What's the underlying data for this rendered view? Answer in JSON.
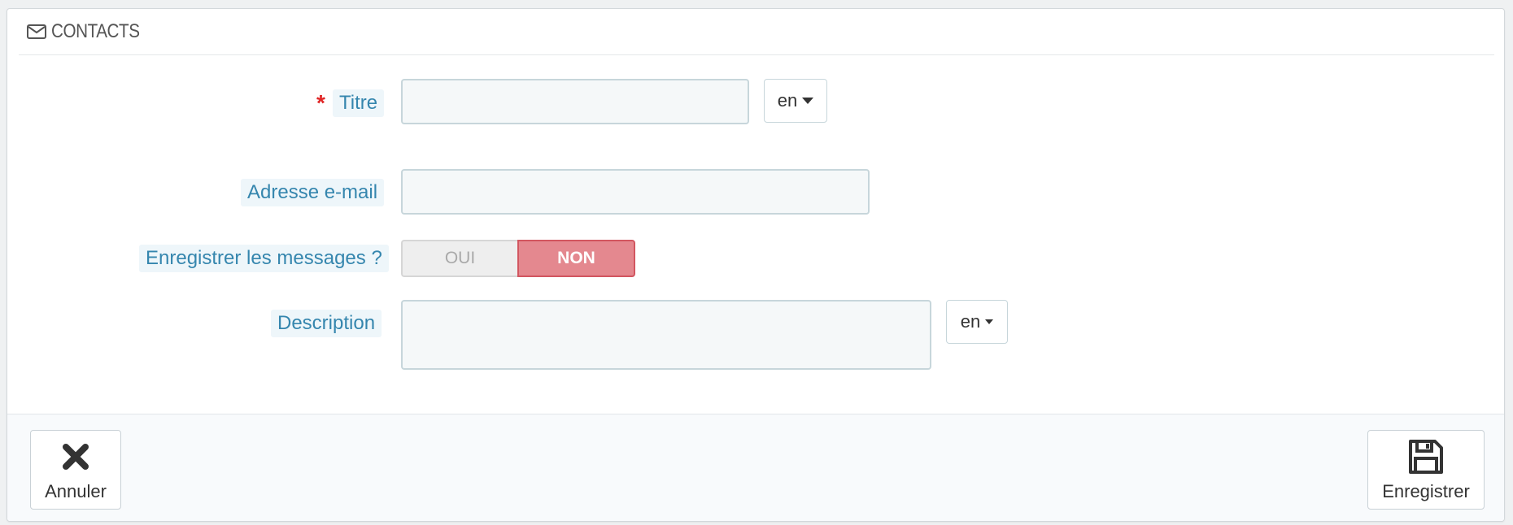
{
  "panel": {
    "heading_icon": "envelope-icon",
    "title": "CONTACTS"
  },
  "form": {
    "title_field": {
      "required_mark": "*",
      "label": "Titre",
      "value": "",
      "language": "en"
    },
    "email_field": {
      "label": "Adresse e-mail",
      "value": ""
    },
    "save_messages": {
      "label": "Enregistrer les messages ?",
      "option_yes": "OUI",
      "option_no": "NON",
      "selected": "NON"
    },
    "description_field": {
      "label": "Description",
      "value": "",
      "language": "en"
    }
  },
  "footer": {
    "cancel_label": "Annuler",
    "cancel_icon": "close-icon",
    "save_label": "Enregistrer",
    "save_icon": "floppy-disk-icon"
  },
  "colors": {
    "label_text": "#3586ae",
    "label_bg": "#eef6fa",
    "required": "#e02525",
    "toggle_active": "#e4888f"
  }
}
